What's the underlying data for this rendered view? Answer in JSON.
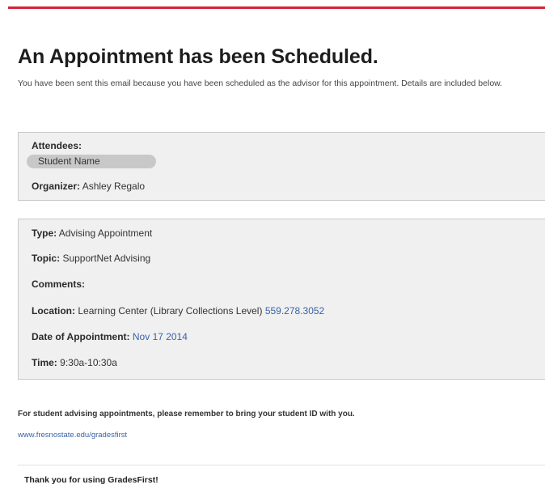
{
  "header": {
    "title": "An Appointment has been Scheduled.",
    "intro": "You have been sent this email because you have been scheduled as the advisor for this appointment. Details are included below."
  },
  "attendees_panel": {
    "attendees_label": "Attendees:",
    "attendee_name": "Student Name",
    "organizer_label": "Organizer:",
    "organizer_value": "Ashley Regalo"
  },
  "details_panel": {
    "type_label": "Type:",
    "type_value": "Advising Appointment",
    "topic_label": "Topic:",
    "topic_value": "SupportNet Advising",
    "comments_label": "Comments:",
    "location_label": "Location:",
    "location_value": "Learning Center (Library Collections Level)",
    "location_phone": "559.278.3052",
    "date_label": "Date of Appointment:",
    "date_value": "Nov 17 2014",
    "time_label": "Time:",
    "time_value": "9:30a-10:30a"
  },
  "footer": {
    "note": "For student advising appointments, please remember to bring your student ID with you.",
    "link": "www.fresnostate.edu/gradesfirst",
    "thanks": "Thank you for using GradesFirst!"
  },
  "colors": {
    "accent_rule": "#d2263a",
    "link": "#3a62a8",
    "panel_bg": "#f0f0f0"
  }
}
